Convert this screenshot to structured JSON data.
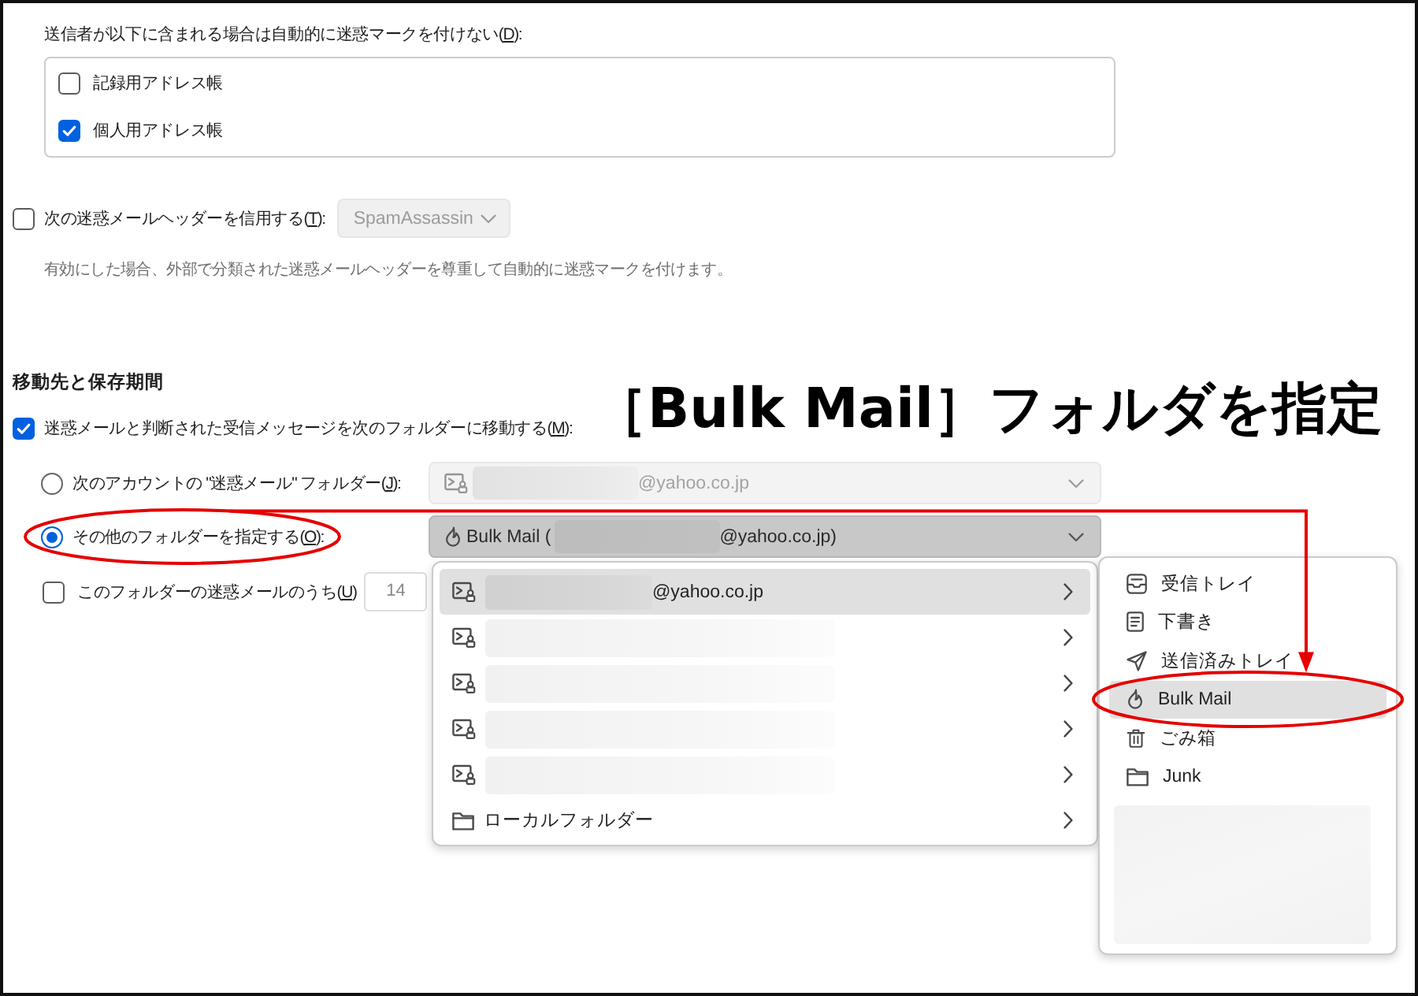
{
  "exceptions": {
    "label": "送信者が以下に含まれる場合は自動的に迷惑マークを付けない(",
    "access_key": "D",
    "label_end": "):",
    "address_books": [
      {
        "label": "記録用アドレス帳",
        "checked": false
      },
      {
        "label": "個人用アドレス帳",
        "checked": true
      }
    ]
  },
  "trust_headers": {
    "label": "次の迷惑メールヘッダーを信用する(",
    "access_key": "T",
    "label_end": "):",
    "checked": false,
    "dropdown": {
      "value": "SpamAssassin",
      "disabled": true
    },
    "hint": "有効にした場合、外部で分類された迷惑メールヘッダーを尊重して自動的に迷惑マークを付けます。"
  },
  "destination": {
    "heading": "移動先と保存期間",
    "move": {
      "label": "迷惑メールと判断された受信メッセージを次のフォルダーに移動する(",
      "access_key": "M",
      "label_end": "):",
      "checked": true
    },
    "options": [
      {
        "label": "次のアカウントの \"迷惑メール\" フォルダー(",
        "access_key": "J",
        "label_end": "):",
        "selected": false,
        "circled": false,
        "dropdown": {
          "kind": "account",
          "redacted": true,
          "value_end": "@yahoo.co.jp",
          "disabled": true,
          "open": false
        }
      },
      {
        "label": "その他のフォルダーを指定する(",
        "access_key": "O",
        "label_end": "):",
        "selected": true,
        "circled": true,
        "dropdown": {
          "kind": "spam",
          "value_start": "Bulk Mail (",
          "redacted": true,
          "value_end": "@yahoo.co.jp)",
          "disabled": false,
          "open": true
        }
      }
    ],
    "purge": {
      "label": "このフォルダーの迷惑メールのうち(",
      "access_key": "U",
      "label_end": ")",
      "checked": false,
      "value": "14"
    }
  },
  "folder_menu": {
    "items": [
      {
        "kind": "account",
        "redacted": true,
        "label": "@yahoo.co.jp",
        "selected": true,
        "submenu": true
      },
      {
        "kind": "account",
        "redacted": true,
        "selected": false,
        "submenu": true
      },
      {
        "kind": "account",
        "redacted": true,
        "selected": false,
        "submenu": true
      },
      {
        "kind": "account",
        "redacted": true,
        "selected": false,
        "submenu": true
      },
      {
        "kind": "account",
        "redacted": true,
        "selected": false,
        "submenu": true
      },
      {
        "kind": "folder",
        "redacted": false,
        "label": "ローカルフォルダー",
        "selected": false,
        "submenu": true
      }
    ]
  },
  "subfolder_menu": {
    "items": [
      {
        "kind": "inbox",
        "label": "受信トレイ",
        "selected": false,
        "circled": false
      },
      {
        "kind": "drafts",
        "label": "下書き",
        "selected": false,
        "circled": false
      },
      {
        "kind": "sent",
        "label": "送信済みトレイ",
        "selected": false,
        "circled": false
      },
      {
        "kind": "spam",
        "label": "Bulk Mail",
        "selected": true,
        "circled": true
      },
      {
        "kind": "trash",
        "label": "ごみ箱",
        "selected": false,
        "circled": false
      },
      {
        "kind": "folder",
        "label": "Junk",
        "selected": false,
        "circled": false
      }
    ],
    "redacted_footer": true
  },
  "annotation": {
    "caption": "［Bulk Mail］フォルダを指定",
    "arrow": true
  }
}
